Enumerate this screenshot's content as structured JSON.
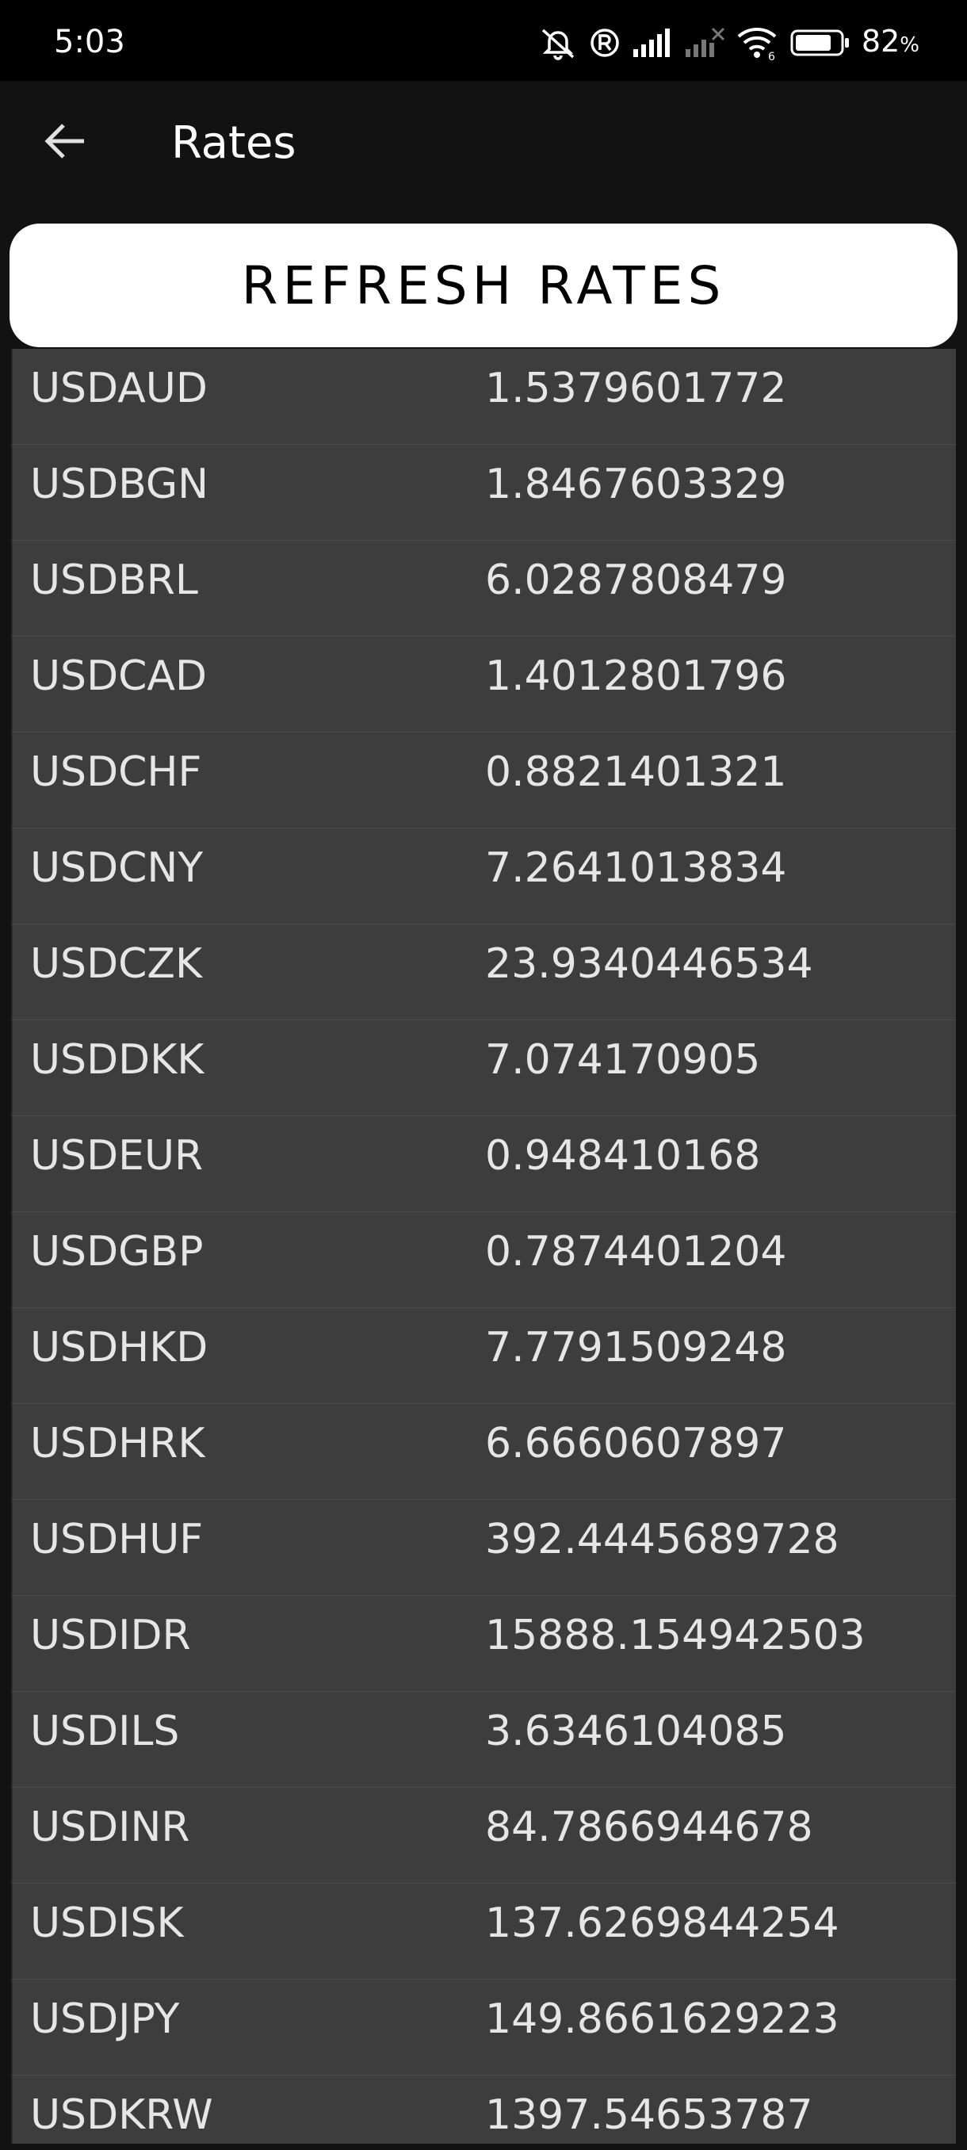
{
  "status_bar": {
    "time": "5:03",
    "battery_percent": "82",
    "battery_unit": "%",
    "icons": [
      "mute-icon",
      "registered-icon",
      "signal-icon",
      "signal-off-icon",
      "wifi-icon",
      "battery-icon"
    ]
  },
  "app_bar": {
    "back_icon": "arrow-left-icon",
    "title": "Rates"
  },
  "refresh_button": {
    "label": "REFRESH RATES"
  },
  "rates": [
    {
      "code": "USDAUD",
      "value": "1.5379601772"
    },
    {
      "code": "USDBGN",
      "value": "1.8467603329"
    },
    {
      "code": "USDBRL",
      "value": "6.0287808479"
    },
    {
      "code": "USDCAD",
      "value": "1.4012801796"
    },
    {
      "code": "USDCHF",
      "value": "0.8821401321"
    },
    {
      "code": "USDCNY",
      "value": "7.2641013834"
    },
    {
      "code": "USDCZK",
      "value": "23.9340446534"
    },
    {
      "code": "USDDKK",
      "value": "7.074170905"
    },
    {
      "code": "USDEUR",
      "value": "0.948410168"
    },
    {
      "code": "USDGBP",
      "value": "0.7874401204"
    },
    {
      "code": "USDHKD",
      "value": "7.7791509248"
    },
    {
      "code": "USDHRK",
      "value": "6.6660607897"
    },
    {
      "code": "USDHUF",
      "value": "392.4445689728"
    },
    {
      "code": "USDIDR",
      "value": "15888.154942503"
    },
    {
      "code": "USDILS",
      "value": "3.6346104085"
    },
    {
      "code": "USDINR",
      "value": "84.7866944678"
    },
    {
      "code": "USDISK",
      "value": "137.6269844254"
    },
    {
      "code": "USDJPY",
      "value": "149.8661629223"
    },
    {
      "code": "USDKRW",
      "value": "1397.54653787"
    }
  ]
}
